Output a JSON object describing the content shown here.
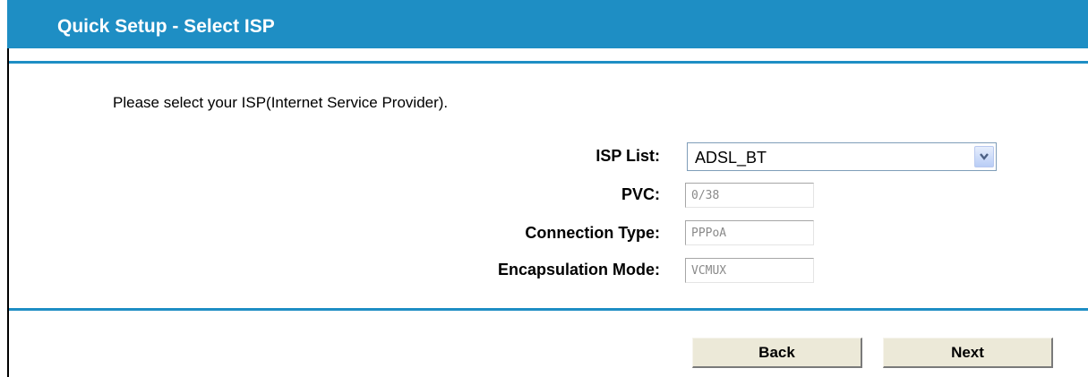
{
  "header": {
    "title": "Quick Setup - Select ISP"
  },
  "prompt": "Please select your ISP(Internet Service Provider).",
  "form": {
    "isp_list": {
      "label": "ISP List:",
      "value": "ADSL_BT"
    },
    "pvc": {
      "label": "PVC:",
      "value": "0/38"
    },
    "connection_type": {
      "label": "Connection Type:",
      "value": "PPPoA"
    },
    "encapsulation_mode": {
      "label": "Encapsulation Mode:",
      "value": "VCMUX"
    }
  },
  "buttons": {
    "back": "Back",
    "next": "Next"
  },
  "colors": {
    "accent": "#1e8ec4"
  }
}
